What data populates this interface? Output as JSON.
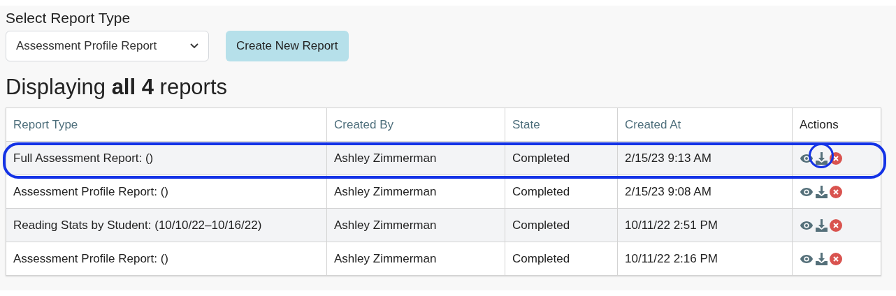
{
  "report_select": {
    "label": "Select Report Type",
    "value": "Assessment Profile Report"
  },
  "create_button": "Create New Report",
  "heading": "Displaying **all 4** reports",
  "table": {
    "columns": [
      {
        "label": "Report Type",
        "sortable": true
      },
      {
        "label": "Created By",
        "sortable": true
      },
      {
        "label": "State",
        "sortable": true
      },
      {
        "label": "Created At",
        "sortable": true
      },
      {
        "label": "Actions",
        "sortable": false
      }
    ],
    "rows": [
      {
        "cells": [
          "Full Assessment Report: ()",
          "Ashley Zimmerman",
          "Completed",
          "2/15/23 9:13 AM"
        ],
        "highlighted": true,
        "download_highlighted": true
      },
      {
        "cells": [
          "Assessment Profile Report: ()",
          "Ashley Zimmerman",
          "Completed",
          "2/15/23 9:08 AM"
        ],
        "highlighted": false,
        "download_highlighted": false
      },
      {
        "cells": [
          "Reading Stats by Student: (10/10/22–10/16/22)",
          "Ashley Zimmerman",
          "Completed",
          "10/11/22 2:51 PM"
        ],
        "highlighted": false,
        "download_highlighted": false
      },
      {
        "cells": [
          "Assessment Profile Report: ()",
          "Ashley Zimmerman",
          "Completed",
          "10/11/22 2:16 PM"
        ],
        "highlighted": false,
        "download_highlighted": false
      }
    ]
  }
}
